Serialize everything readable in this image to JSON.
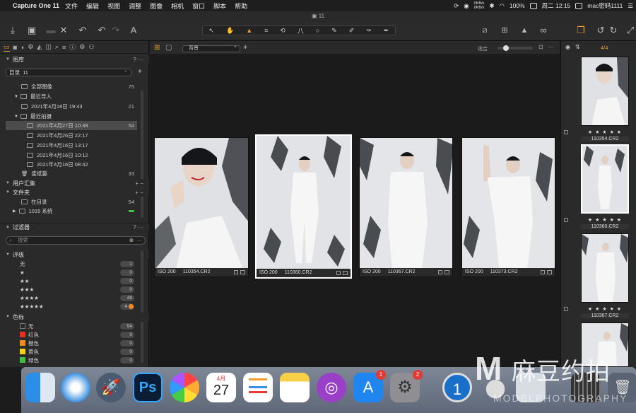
{
  "menubar": {
    "app": "Capture One 11",
    "menus": [
      "文件",
      "编辑",
      "视图",
      "调整",
      "图像",
      "相机",
      "窗口",
      "脚本",
      "帮助"
    ],
    "netspeed_up": "0KB/s",
    "netspeed_down": "0KB/s",
    "battery": "100%",
    "clock": "周二 12:15",
    "user": "mac密码1111"
  },
  "window": {
    "title": "11"
  },
  "library": {
    "section_title": "图库",
    "catalog_label": "目录: 11",
    "items": [
      {
        "label": "全部图像",
        "count": "75"
      },
      {
        "label": "最近导入",
        "count": ""
      },
      {
        "label": "2021年4月18日 19:43",
        "count": "21"
      },
      {
        "label": "最近拍摄",
        "count": ""
      },
      {
        "label": "2021年4月27日 10:49",
        "count": "54"
      },
      {
        "label": "2021年4月26日 22:17",
        "count": ""
      },
      {
        "label": "2021年4月16日 13:17",
        "count": ""
      },
      {
        "label": "2021年4月16日 10:12",
        "count": ""
      },
      {
        "label": "2021年4月16日 08:42",
        "count": ""
      },
      {
        "label": "废纸篓",
        "count": "33"
      }
    ],
    "user_collections": "用户汇集",
    "folders": "文件夹",
    "in_catalog": {
      "label": "在目录",
      "count": "54"
    },
    "volume": "1015 系统"
  },
  "filters": {
    "section_title": "过滤器",
    "search_placeholder": "搜索",
    "rating_title": "评级",
    "ratings": [
      {
        "label": "无",
        "count": "1"
      },
      {
        "label": "★",
        "count": "0"
      },
      {
        "label": "★★",
        "count": "0"
      },
      {
        "label": "★★★",
        "count": "0"
      },
      {
        "label": "★★★★",
        "count": "49"
      },
      {
        "label": "★★★★★",
        "count": "4"
      }
    ],
    "color_title": "色标",
    "colors": [
      {
        "label": "无",
        "count": "54",
        "color": "#2a2a2a"
      },
      {
        "label": "红色",
        "count": "0",
        "color": "#e53020"
      },
      {
        "label": "橙色",
        "count": "0",
        "color": "#f08a20"
      },
      {
        "label": "黄色",
        "count": "0",
        "color": "#f2d020"
      },
      {
        "label": "绿色",
        "count": "0",
        "color": "#40c040"
      }
    ]
  },
  "viewer": {
    "variant_select": "背景",
    "fit_label": "适合",
    "thumbs": [
      {
        "iso": "ISO 200",
        "name": "110354.CR2"
      },
      {
        "iso": "ISO 200",
        "name": "110360.CR2"
      },
      {
        "iso": "ISO 200",
        "name": "110367.CR2"
      },
      {
        "iso": "ISO 200",
        "name": "110373.CR2"
      }
    ]
  },
  "browser": {
    "counter": "4/4",
    "items": [
      {
        "stars": "★ ★ ★ ★ ★",
        "name": "110354.CR2"
      },
      {
        "stars": "★ ★ ★ ★ ★",
        "name": "110360.CR2"
      },
      {
        "stars": "★ ★ ★ ★ ★",
        "name": "110367.CR2"
      }
    ]
  },
  "dock": {
    "calendar_month": "4月",
    "calendar_day": "27",
    "badge_appstore": "1",
    "badge_prefs": "2"
  },
  "watermark": {
    "brand": "麻豆约拍",
    "sub": "MODELPHOTOGRAPHY"
  }
}
